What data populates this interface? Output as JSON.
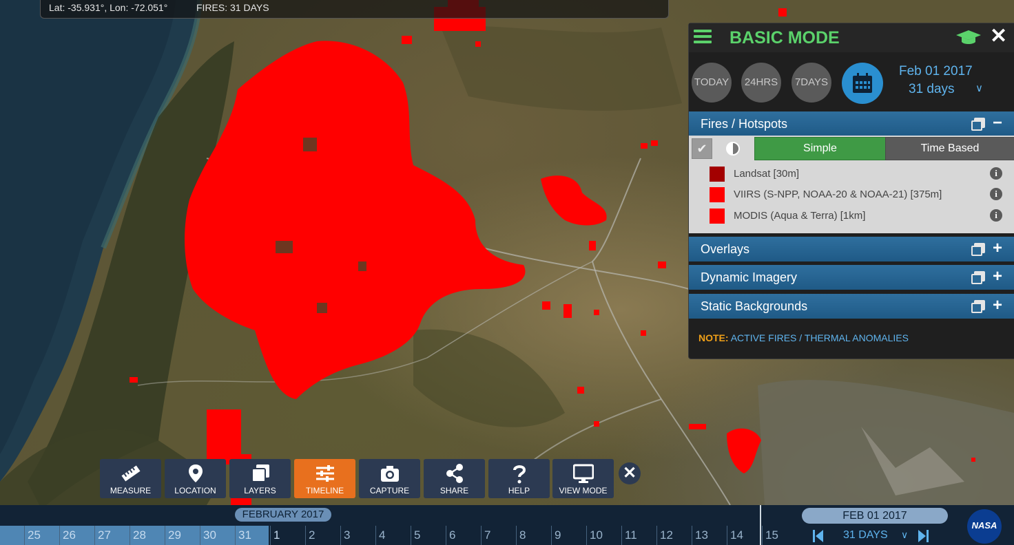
{
  "coords": {
    "latlon": "Lat: -35.931°, Lon: -72.051°",
    "fires": "FIRES: 31 DAYS"
  },
  "panel": {
    "title": "BASIC MODE",
    "icons": {
      "menu": "hamburger-icon",
      "tour": "graduation-cap-icon",
      "close": "close-icon"
    },
    "quick_buttons": [
      "TODAY",
      "24HRS",
      "7DAYS"
    ],
    "date": "Feb 01 2017",
    "range": "31 days",
    "sections": {
      "fires": "Fires / Hotspots",
      "overlays": "Overlays",
      "dynamic": "Dynamic Imagery",
      "static": "Static Backgrounds"
    },
    "tabs": {
      "simple": "Simple",
      "time_based": "Time Based"
    },
    "legend": [
      {
        "label": "Landsat [30m]",
        "color": "#a30000"
      },
      {
        "label": "VIIRS (S-NPP, NOAA-20 & NOAA-21) [375m]",
        "color": "#ff0000"
      },
      {
        "label": "MODIS (Aqua & Terra) [1km]",
        "color": "#ff0000"
      }
    ],
    "note_key": "NOTE:",
    "note_value": "ACTIVE FIRES / THERMAL ANOMALIES"
  },
  "toolbar": {
    "items": [
      {
        "label": "MEASURE",
        "icon": "ruler-icon"
      },
      {
        "label": "LOCATION",
        "icon": "map-pin-icon"
      },
      {
        "label": "LAYERS",
        "icon": "layers-icon"
      },
      {
        "label": "TIMELINE",
        "icon": "sliders-icon",
        "active": true
      },
      {
        "label": "CAPTURE",
        "icon": "camera-icon"
      },
      {
        "label": "SHARE",
        "icon": "share-icon"
      },
      {
        "label": "HELP",
        "icon": "question-icon"
      },
      {
        "label": "VIEW MODE",
        "icon": "monitor-icon"
      }
    ]
  },
  "timeline": {
    "month": "FEBRUARY 2017",
    "days": [
      "25",
      "26",
      "27",
      "28",
      "29",
      "30",
      "31",
      "1",
      "2",
      "3",
      "4",
      "5",
      "6",
      "7",
      "8",
      "9",
      "10",
      "11",
      "12",
      "13",
      "14",
      "15"
    ],
    "current_date": "FEB 01 2017",
    "range": "31 DAYS",
    "logo": "NASA"
  },
  "colors": {
    "accent": "#5bd26b",
    "active_tool": "#e8701e",
    "fire": "#ff0000",
    "link": "#5fb4ee"
  }
}
